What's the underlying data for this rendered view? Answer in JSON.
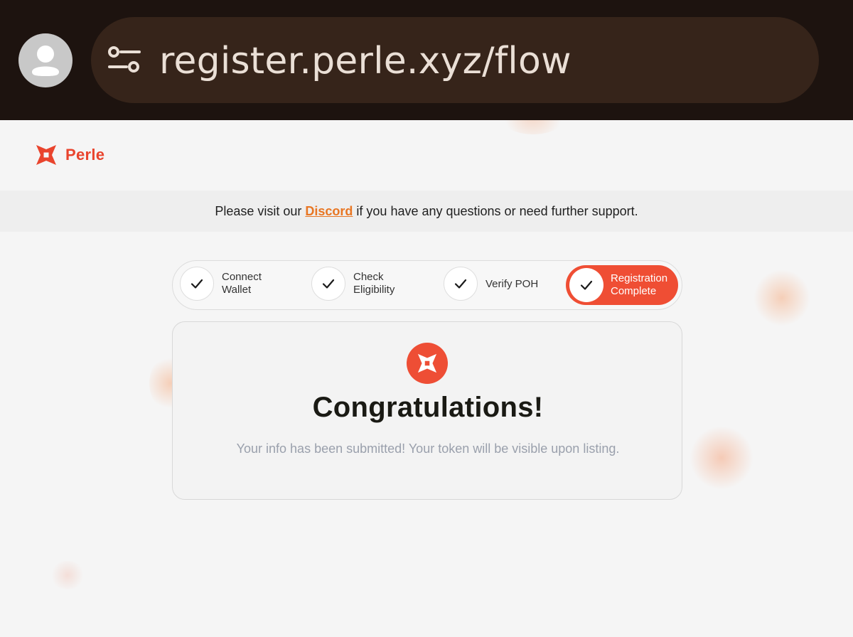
{
  "browser": {
    "url": "register.perle.xyz/flow"
  },
  "brand": {
    "name": "Perle",
    "color": "#e9442d"
  },
  "notice": {
    "before": "Please visit our ",
    "link": "Discord",
    "after": " if you have any questions or need further support."
  },
  "steps": [
    {
      "line1": "Connect",
      "line2": "Wallet",
      "state": "done"
    },
    {
      "line1": "Check",
      "line2": "Eligibility",
      "state": "done"
    },
    {
      "line1": "Verify POH",
      "line2": "",
      "state": "done"
    },
    {
      "line1": "Registration",
      "line2": "Complete",
      "state": "active"
    }
  ],
  "card": {
    "title": "Congratulations!",
    "message": "Your info has been submitted! Your token will be visible upon listing."
  },
  "colors": {
    "accent": "#ef4e34",
    "link": "#e87623",
    "browser_bg": "#1d130f",
    "url_pill": "#36241a"
  }
}
